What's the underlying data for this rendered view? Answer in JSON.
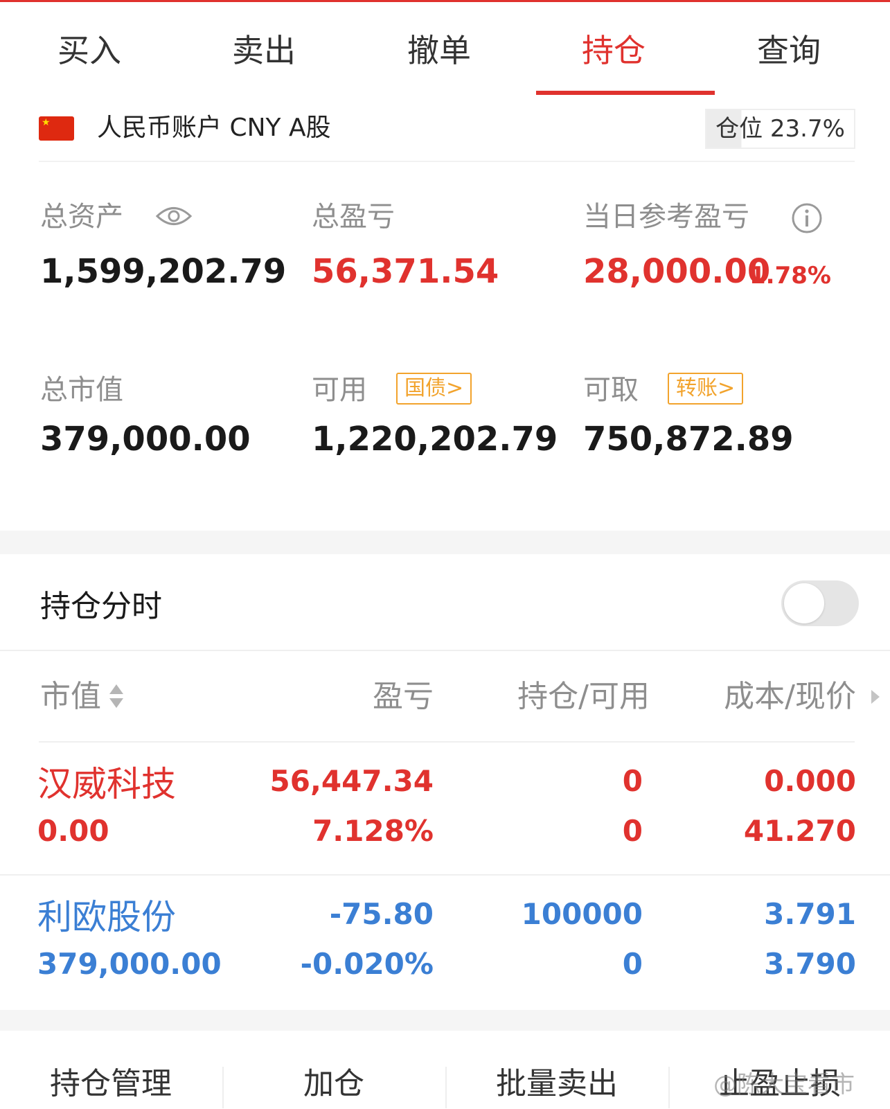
{
  "tabs": [
    {
      "label": "买入"
    },
    {
      "label": "卖出"
    },
    {
      "label": "撤单"
    },
    {
      "label": "持仓",
      "active": true
    },
    {
      "label": "查询"
    }
  ],
  "account": {
    "label": "人民币账户 CNY A股",
    "position_ratio_text": "仓位 23.7%",
    "position_ratio": 0.237
  },
  "summary": {
    "total_assets_label": "总资产",
    "total_assets": "1,599,202.79",
    "total_pl_label": "总盈亏",
    "total_pl": "56,371.54",
    "daily_pl_label": "当日参考盈亏",
    "daily_pl": "28,000.00",
    "daily_pl_pct": "1.78%",
    "market_value_label": "总市值",
    "market_value": "379,000.00",
    "available_label": "可用",
    "available_badge": "国债>",
    "available": "1,220,202.79",
    "withdrawable_label": "可取",
    "withdrawable_badge": "转账>",
    "withdrawable": "750,872.89"
  },
  "holdings": {
    "title": "持仓分时",
    "toggle_on": false,
    "columns": [
      "市值",
      "盈亏",
      "持仓/可用",
      "成本/现价"
    ],
    "rows": [
      {
        "name": "汉威科技",
        "market_value": "0.00",
        "pl": "56,447.34",
        "pl_pct": "7.128%",
        "position": "0",
        "available": "0",
        "cost": "0.000",
        "price": "41.270",
        "color": "#e0322e"
      },
      {
        "name": "利欧股份",
        "market_value": "379,000.00",
        "pl": "-75.80",
        "pl_pct": "-0.020%",
        "position": "100000",
        "available": "0",
        "cost": "3.791",
        "price": "3.790",
        "color": "#3b7fd4"
      }
    ]
  },
  "bottom_bar": [
    "持仓管理",
    "加仓",
    "批量卖出",
    "止盈止损"
  ],
  "watermark": "@陈大宝看市",
  "colors": {
    "accent": "#e0322e",
    "down": "#3b7fd4",
    "badge": "#f2a32c"
  }
}
